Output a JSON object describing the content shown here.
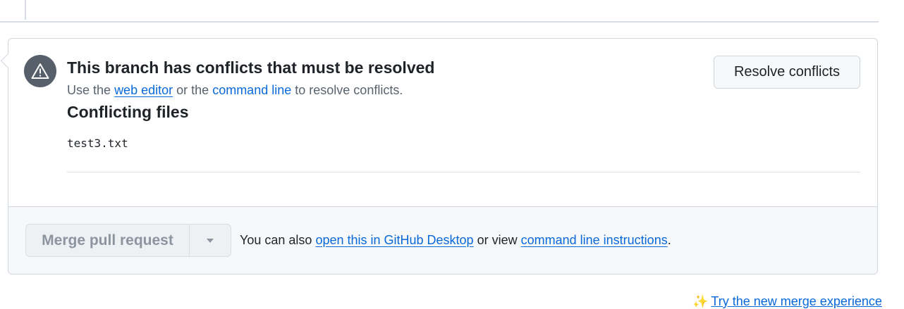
{
  "conflict": {
    "title": "This branch has conflicts that must be resolved",
    "subtitle_prefix": "Use the",
    "web_editor_link": "web editor",
    "subtitle_middle": "or the",
    "command_line_link": "command line",
    "subtitle_suffix": "to resolve conflicts.",
    "files_heading": "Conflicting files",
    "files": [
      "test3.txt"
    ],
    "resolve_button": "Resolve conflicts"
  },
  "footer": {
    "merge_button": "Merge pull request",
    "text_prefix": "You can also",
    "desktop_link": "open this in GitHub Desktop",
    "text_middle": "or view",
    "instructions_link": "command line instructions",
    "text_suffix": "."
  },
  "bottom_link": {
    "icon": "sparkle-icon",
    "label": "Try the new merge experience"
  },
  "colors": {
    "link": "#0969da",
    "icon_bg": "#57606a",
    "border": "#d0d7de",
    "footer_bg": "#f6f8fa"
  }
}
